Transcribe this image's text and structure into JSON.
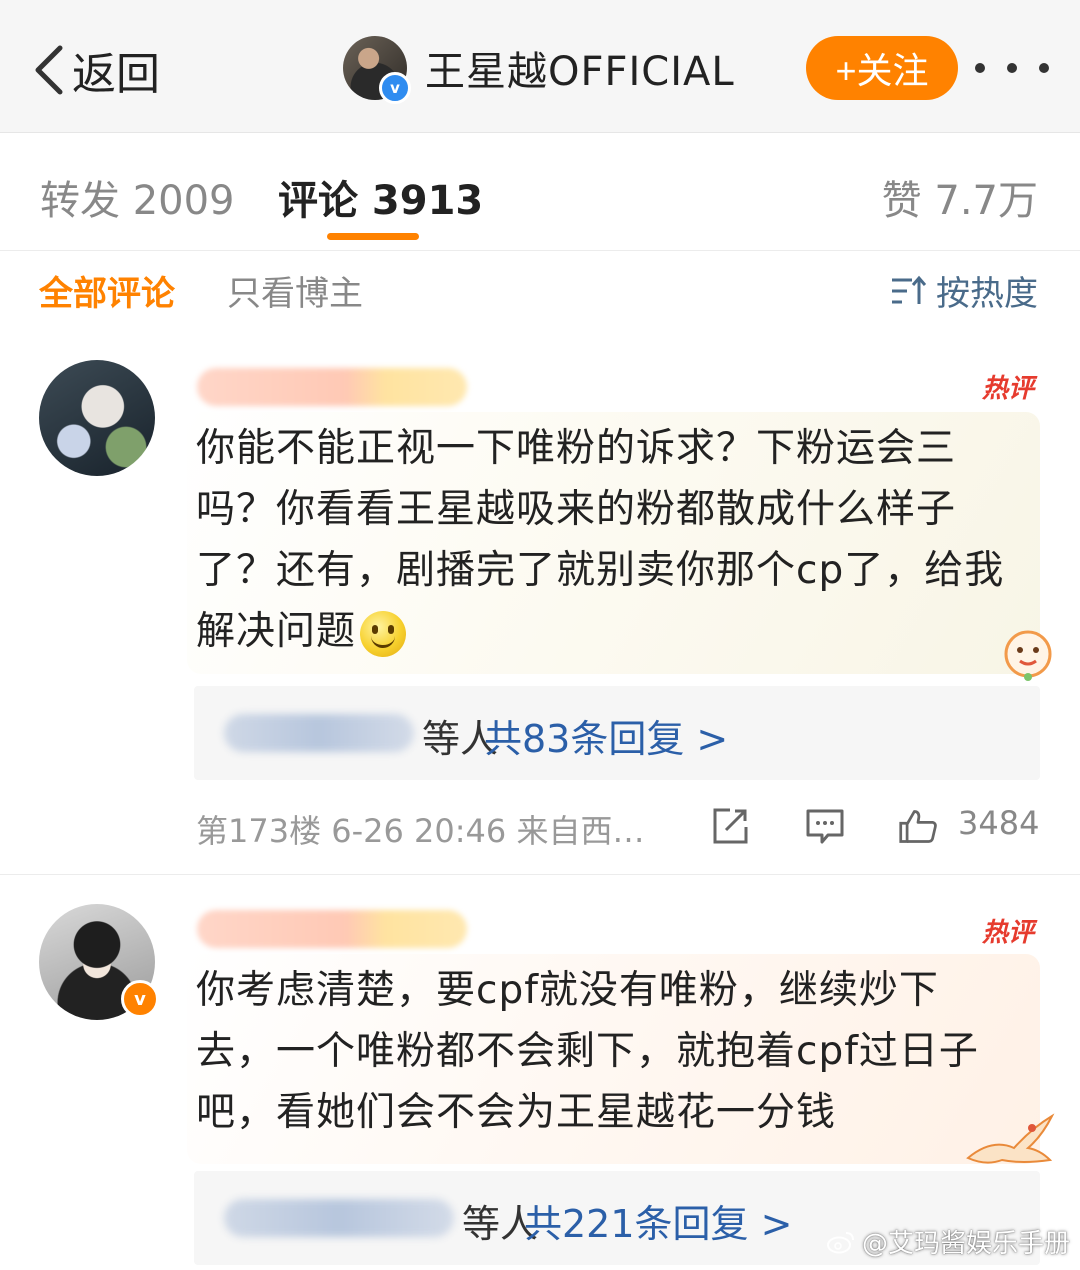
{
  "topbar": {
    "back_label": "返回",
    "author_name": "王星越OFFICIAL",
    "verified_badge": "v",
    "follow_label": "+关注",
    "more_icon": "more-dots-icon"
  },
  "tabs": {
    "repost": "转发 2009",
    "comment": "评论 3913",
    "like": "赞 7.7万",
    "active": "comment"
  },
  "filter": {
    "all": "全部评论",
    "owner_only": "只看博主",
    "sort": "按热度"
  },
  "comments": [
    {
      "badge": "热评",
      "text": "你能不能正视一下唯粉的诉求？下粉运会三吗？你看看王星越吸来的粉都散成什么样子了？还有，剧播完了就别卖你那个cp了，给我解决问题",
      "replies_tail": "等人",
      "replies_count": "共83条回复 >",
      "meta": "第173楼 6-26 20:46 来自西…",
      "likes": "3484"
    },
    {
      "badge": "热评",
      "verified_badge": "v",
      "text": "你考虑清楚，要cpf就没有唯粉，继续炒下去，一个唯粉都不会剩下，就抱着cpf过日子吧，看她们会不会为王星越花一分钱",
      "replies_tail": "等人",
      "replies_count": "共221条回复 >"
    }
  ],
  "watermark": "@艾玛酱娱乐手册",
  "colors": {
    "accent": "#ff8200",
    "link": "#2b5fa8",
    "hot": "#e63b2e",
    "verified_blue": "#2f8cf0"
  }
}
